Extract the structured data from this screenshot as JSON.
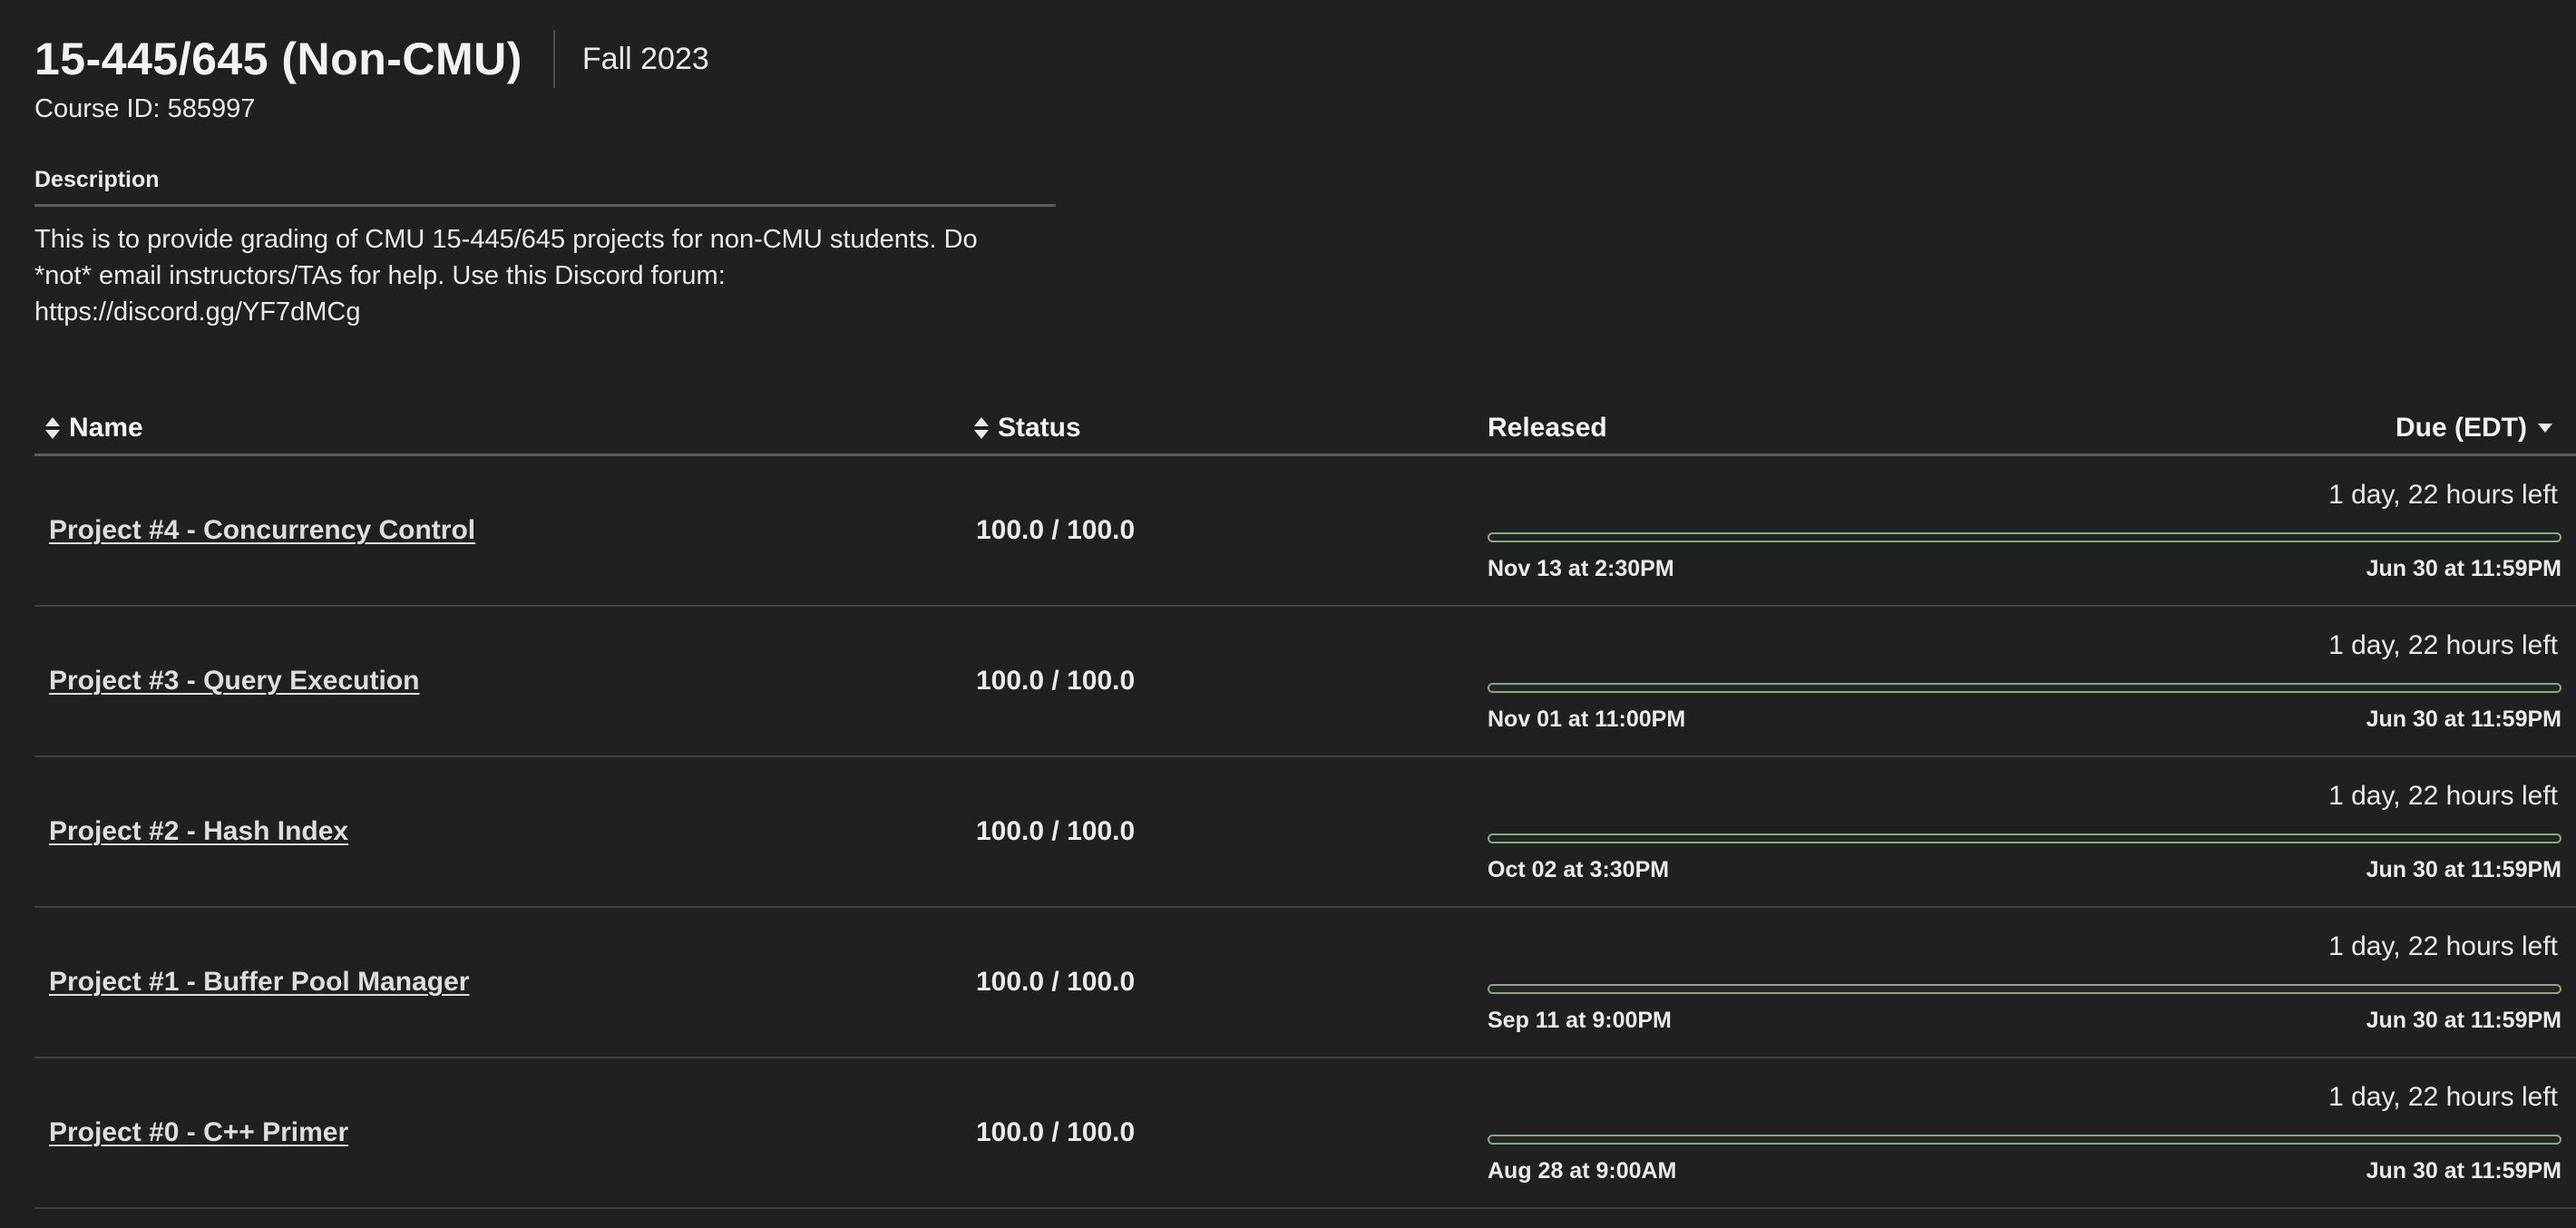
{
  "course": {
    "title": "15-445/645 (Non-CMU)",
    "term": "Fall 2023",
    "course_id": "Course ID: 585997"
  },
  "description": {
    "heading": "Description",
    "text_line1": "This is to provide grading of CMU 15-445/645 projects for non-CMU students. Do",
    "text_line2": "*not* email instructors/TAs for help. Use this Discord forum:",
    "text_line3": "https://discord.gg/YF7dMCg"
  },
  "table": {
    "headers": {
      "name": "Name",
      "status": "Status",
      "released": "Released",
      "due": "Due (EDT)"
    },
    "rows": [
      {
        "name": "Project #4 - Concurrency Control",
        "status": "100.0 / 100.0",
        "time_left": "1 day, 22 hours left",
        "released": "Nov 13 at 2:30PM",
        "due": "Jun 30 at 11:59PM",
        "progress": 0
      },
      {
        "name": "Project #3 - Query Execution",
        "status": "100.0 / 100.0",
        "time_left": "1 day, 22 hours left",
        "released": "Nov 01 at 11:00PM",
        "due": "Jun 30 at 11:59PM",
        "progress": 0
      },
      {
        "name": "Project #2 - Hash Index",
        "status": "100.0 / 100.0",
        "time_left": "1 day, 22 hours left",
        "released": "Oct 02 at 3:30PM",
        "due": "Jun 30 at 11:59PM",
        "progress": 0
      },
      {
        "name": "Project #1 - Buffer Pool Manager",
        "status": "100.0 / 100.0",
        "time_left": "1 day, 22 hours left",
        "released": "Sep 11 at 9:00PM",
        "due": "Jun 30 at 11:59PM",
        "progress": 0
      },
      {
        "name": "Project #0 - C++ Primer",
        "status": "100.0 / 100.0",
        "time_left": "1 day, 22 hours left",
        "released": "Aug 28 at 9:00AM",
        "due": "Jun 30 at 11:59PM",
        "progress": 0
      }
    ]
  },
  "colors": {
    "background": "#1f2022",
    "progress_border": "#8aa87a"
  },
  "icons": {
    "sort": "sort-icon",
    "sort_desc": "caret-down-icon"
  }
}
